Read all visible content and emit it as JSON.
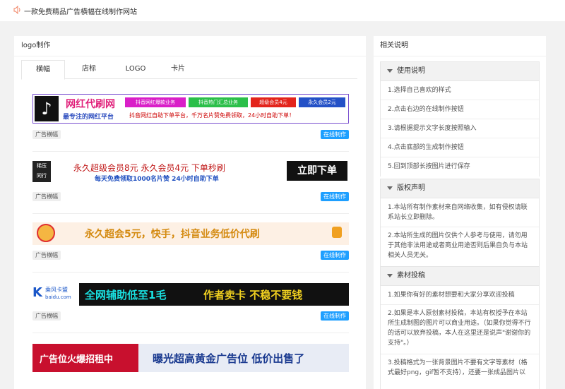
{
  "header": {
    "title": "一款免费精品广告横幅在线制作网站"
  },
  "left": {
    "title": "logo制作",
    "tabs": [
      "横幅",
      "店标",
      "LOGO",
      "卡片"
    ],
    "tag_label": "广告横幅",
    "make_label": "在线制作",
    "banners": [
      {
        "text1": "网红代刷网",
        "text2": "最专注的网红平台",
        "badges": [
          "抖音网红爆款业务",
          "抖音热门汇总业务",
          "超级会员4元",
          "永久会员2元"
        ],
        "line2": "抖音网红自助下单平台，千万名片赞免费领取，24小时自助下单！"
      },
      {
        "logo": [
          "稀",
          "压",
          "同",
          "行"
        ],
        "line1": "永久超级会员8元  永久会员4元  下单秒刷",
        "line2": "每天免费领取1000名片赞  24小时自助下单",
        "button": "立即下单"
      },
      {
        "text": "永久超会5元，快手，抖音业务低价代刷"
      },
      {
        "brand": "乘风卡盟",
        "site": "baidu.com",
        "text1": "全网辅助低至1毛",
        "text2": "作者卖卡 不稳不要钱"
      },
      {
        "text1": "广告位火爆招租中",
        "text2": "曝光超高黄金广告位 低价出售了"
      }
    ]
  },
  "right": {
    "title": "相关说明",
    "sections": [
      {
        "title": "使用说明",
        "lines": [
          "1.选择自己喜欢的样式",
          "2.点击右边的在线制作按钮",
          "3.请根据提示文字长度按照输入",
          "4.点击底部的生成制作按钮",
          "5.回到顶部长按图片进行保存"
        ]
      },
      {
        "title": "版权声明",
        "lines": [
          "1.本站所有制作素材来自网络收集，如有侵权请联系站长立即删除。",
          "2.本站所生成的图片仅供个人参考与使用，请勿用于其他非法用途或者商业用途否则后果自负与本站相关人员无关。"
        ]
      },
      {
        "title": "素材投稿",
        "lines": [
          "1.如果你有好的素材想要和大家分享欢迎投稿",
          "2.如果是本人原创素材投稿，本站有权授予在本站所生成制图的图片可以商业用途。（如果你觉得不行的话可以放弃投稿，本人在这里还是说声\"谢谢你的支持\"。）",
          "3.投稿格式为一张背景图片不要有文字等素材（格式最好png，gif暂不支持），还要一张成品图片以"
        ]
      }
    ]
  }
}
